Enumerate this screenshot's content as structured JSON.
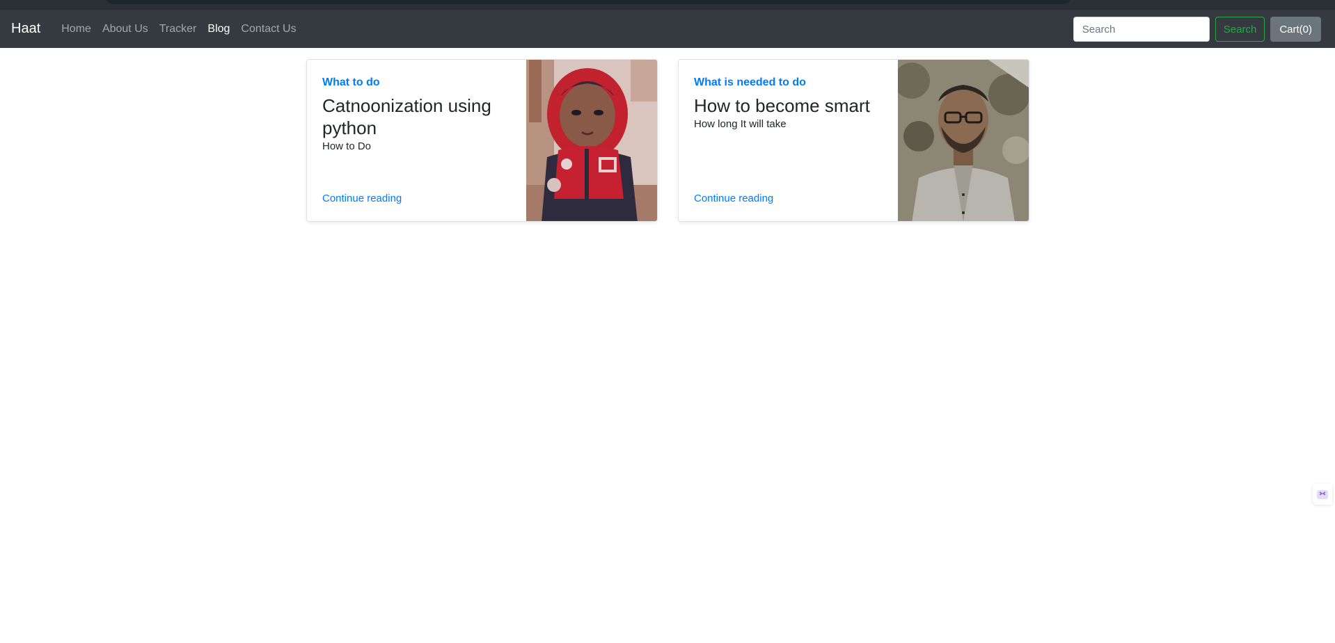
{
  "navbar": {
    "brand": "Haat",
    "links": [
      {
        "label": "Home",
        "active": false
      },
      {
        "label": "About Us",
        "active": false
      },
      {
        "label": "Tracker",
        "active": false
      },
      {
        "label": "Blog",
        "active": true
      },
      {
        "label": "Contact Us",
        "active": false
      }
    ],
    "search": {
      "placeholder": "Search",
      "value": "",
      "button_label": "Search"
    },
    "cart_label": "Cart(0)"
  },
  "posts": [
    {
      "category": "What to do",
      "title": "Catnoonization using python",
      "subtitle": "How to Do",
      "link_label": "Continue reading",
      "image_icon": "child-in-red-hoodie-photo"
    },
    {
      "category": "What is needed to do",
      "title": "How to become smart",
      "subtitle": "How long It will take",
      "link_label": "Continue reading",
      "image_icon": "man-with-glasses-photo"
    }
  ],
  "colors": {
    "navbar_bg": "#343a40",
    "link_blue": "#007bff",
    "search_green": "#28a745",
    "cart_gray": "#6c757d"
  },
  "side_widget_icon": "assistant-widget-icon"
}
